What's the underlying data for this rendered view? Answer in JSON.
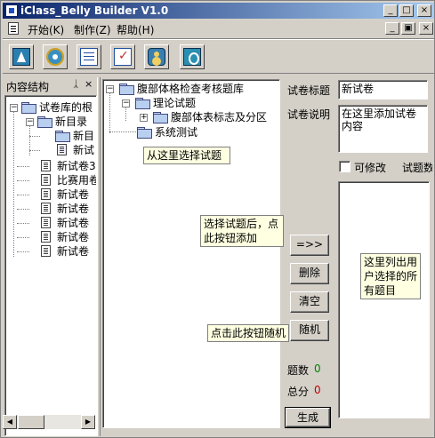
{
  "window": {
    "title": "iClass_Belly Builder V1.0"
  },
  "title_buttons": [
    "_",
    "□",
    "×"
  ],
  "mdi_buttons": [
    "_",
    "▣",
    "×"
  ],
  "menu": [
    {
      "label": "开始(K)"
    },
    {
      "label": "制作(Z)"
    },
    {
      "label": "帮助(H)"
    }
  ],
  "toolbar": [
    "up-icon",
    "gear-icon",
    "list-icon",
    "checklist-icon",
    "people-icon",
    "power-icon"
  ],
  "left_panel": {
    "title": "内容结构",
    "pin": "ᛣ",
    "close": "×",
    "tree": [
      {
        "label": "试卷库的根",
        "type": "folder",
        "expander": "−"
      },
      {
        "label": "新目录",
        "type": "folder",
        "expander": "−"
      },
      {
        "label": "新目",
        "type": "folder"
      },
      {
        "label": "新试",
        "type": "doc-edit"
      },
      {
        "label": "新试卷3",
        "type": "doc"
      },
      {
        "label": "比赛用卷",
        "type": "doc"
      },
      {
        "label": "新试卷",
        "type": "doc"
      },
      {
        "label": "新试卷",
        "type": "doc"
      },
      {
        "label": "新试卷",
        "type": "doc"
      },
      {
        "label": "新试卷",
        "type": "doc"
      },
      {
        "label": "新试卷",
        "type": "doc"
      }
    ],
    "scroll_left": "◀",
    "scroll_right": "▶"
  },
  "question_tree": [
    {
      "label": "腹部体格检查考核题库",
      "expander": "−"
    },
    {
      "label": "理论试题",
      "expander": "−"
    },
    {
      "label": "腹部体表标志及分区",
      "expander": "+"
    },
    {
      "label": "系统测试"
    }
  ],
  "tips": {
    "select": "从这里选择试题",
    "add": "选择试题后，点此按钮添加",
    "random": "点击此按钮随机",
    "list": "这里列出用户选择的所有题目"
  },
  "form": {
    "title_label": "试卷标题",
    "title_value": "新试卷",
    "desc_label": "试卷说明",
    "desc_value": "在这里添加试卷内容",
    "editable_label": "可修改",
    "count_label_short": "试题数"
  },
  "buttons": {
    "add": "=>>",
    "delete": "删除",
    "clear": "清空",
    "random": "随机",
    "generate": "生成"
  },
  "stats": {
    "count_label": "题数",
    "count_value": "0",
    "score_label": "总分",
    "score_value": "0"
  },
  "colors": {
    "count_value": "#008000",
    "score_value": "#c00000"
  }
}
